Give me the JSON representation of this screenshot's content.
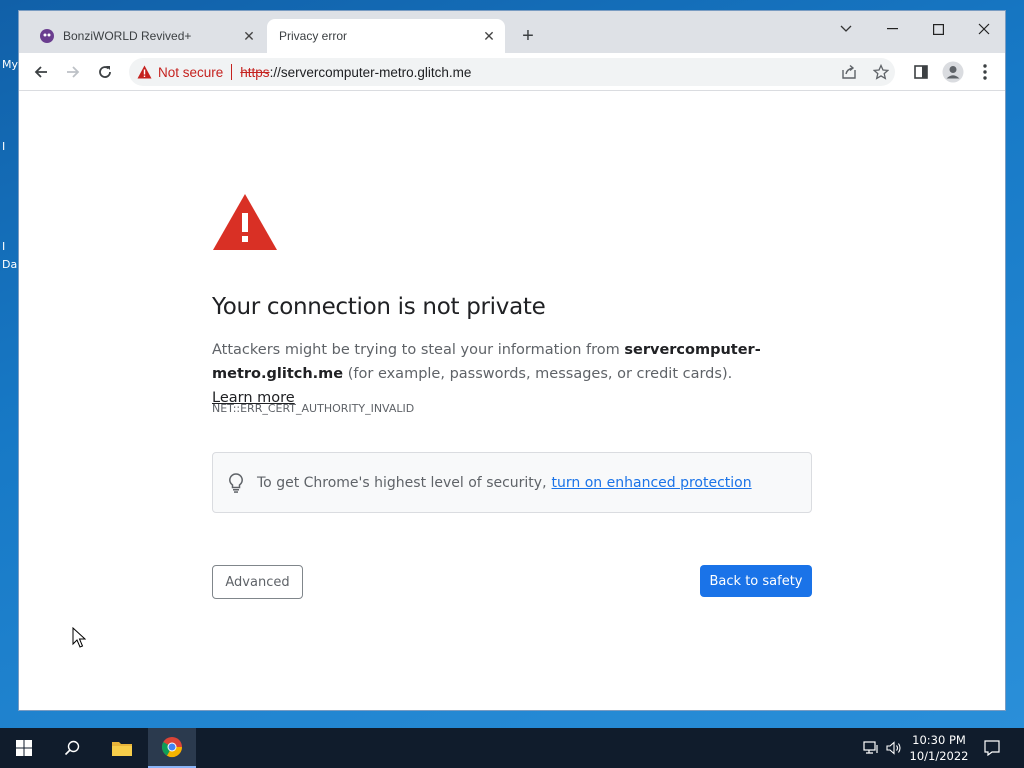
{
  "desktop": {
    "label_my": "My",
    "label_i": "I",
    "label_da": "Da"
  },
  "browser": {
    "tabs": [
      {
        "label": "BonziWORLD Revived+",
        "active": false
      },
      {
        "label": "Privacy error",
        "active": true
      }
    ],
    "new_tab_label": "+",
    "address": {
      "security_label": "Not secure",
      "scheme": "https",
      "rest": "://servercomputer-metro.glitch.me"
    }
  },
  "page": {
    "heading": "Your connection is not private",
    "body_prefix": "Attackers might be trying to steal your information from ",
    "body_host": "servercomputer-metro.glitch.me",
    "body_suffix": " (for example, passwords, messages, or credit cards). ",
    "learn_more": "Learn more",
    "error_code": "NET::ERR_CERT_AUTHORITY_INVALID",
    "protection_text": "To get Chrome's highest level of security,",
    "protection_link": "turn on enhanced protection",
    "advanced_button": "Advanced",
    "safety_button": "Back to safety"
  },
  "colors": {
    "accent": "#1a73e8",
    "danger": "#c5221f",
    "warning_icon": "#d93025"
  },
  "taskbar": {
    "time": "10:30 PM",
    "date": "10/1/2022"
  }
}
